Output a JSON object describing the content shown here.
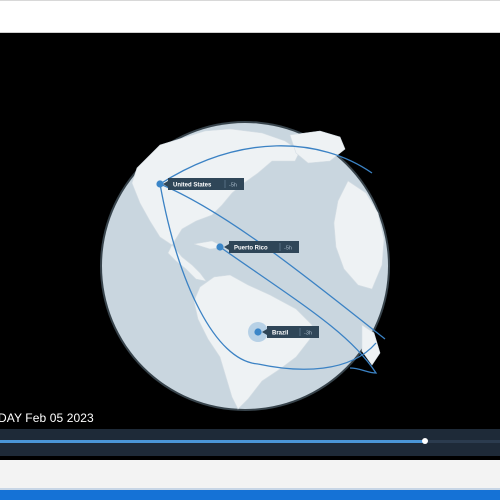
{
  "colors": {
    "background": "#000000",
    "ocean": "#c9d6df",
    "land": "#eef2f4",
    "route": "#3b82c4",
    "marker": "#3b86c8",
    "label_bg": "#2f4658",
    "timeline_bg": "#1e2a38",
    "timeline_fill": "#4a95d6",
    "accent_bar": "#1572d6"
  },
  "locations": [
    {
      "name": "United States",
      "offset": "-5h"
    },
    {
      "name": "Puerto Rico",
      "offset": "-5h"
    },
    {
      "name": "Brazil",
      "offset": "-3h"
    }
  ],
  "timeline": {
    "date_text": "DAY Feb 05 2023",
    "progress": 0.85
  }
}
